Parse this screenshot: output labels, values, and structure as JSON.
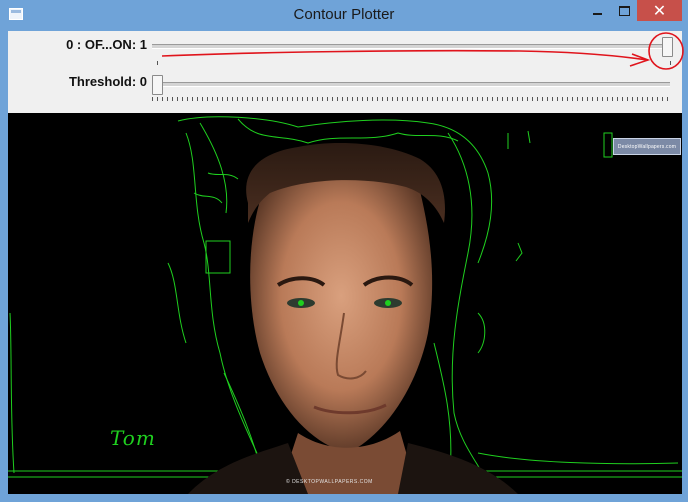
{
  "window": {
    "title": "Contour Plotter",
    "close_glyph": "✕",
    "icons": [
      "app-icon",
      "minimize-icon",
      "maximize-icon",
      "close-icon"
    ]
  },
  "trackbars": [
    {
      "label": "0 : OF...ON: 1",
      "value": 1,
      "max": 1
    },
    {
      "label": "Threshold: 0",
      "value": 0,
      "max": 255
    }
  ],
  "image": {
    "watermark": "DesktopWallpapers.com",
    "signature": "Tom",
    "footer": "© DESKTOPWALLPAPERS.COM"
  },
  "colors": {
    "titlebar": "#6fa3d8",
    "panel": "#f0f0f0",
    "contour": "#1fcf1f",
    "annotation": "#e0141c",
    "close": "#c7504a"
  }
}
